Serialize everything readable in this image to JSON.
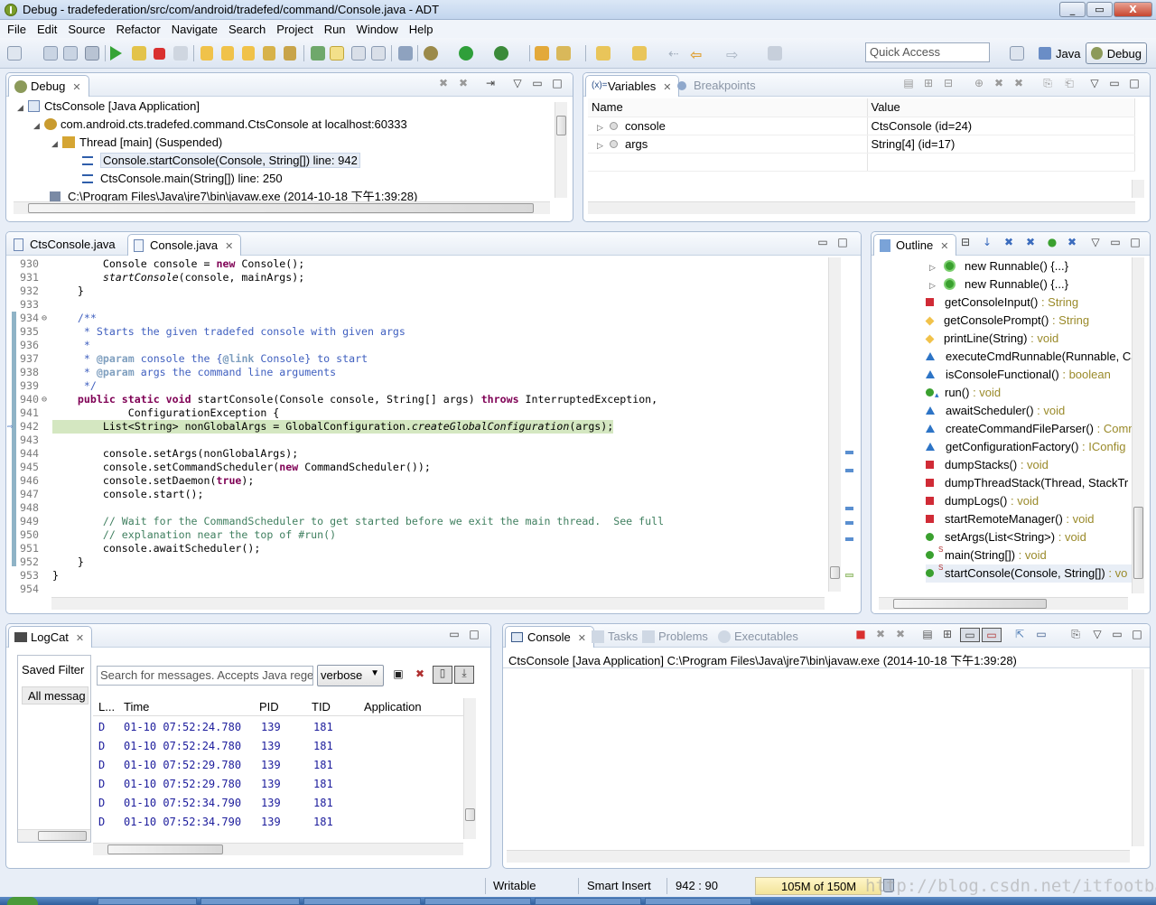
{
  "window": {
    "title": "Debug - tradefederation/src/com/android/tradefed/command/Console.java - ADT",
    "buttons": [
      "_",
      "▭",
      "X"
    ]
  },
  "menu": [
    "File",
    "Edit",
    "Source",
    "Refactor",
    "Navigate",
    "Search",
    "Project",
    "Run",
    "Window",
    "Help"
  ],
  "toolbar": {
    "quick_access_placeholder": "Quick Access",
    "perspectives": [
      "Java",
      "Debug"
    ]
  },
  "debug_view": {
    "tab": "Debug",
    "tree": [
      {
        "label": "CtsConsole [Java Application]"
      },
      {
        "label": "com.android.cts.tradefed.command.CtsConsole at localhost:60333"
      },
      {
        "label": "Thread [main] (Suspended)"
      },
      {
        "label": "Console.startConsole(Console, String[]) line: 942"
      },
      {
        "label": "CtsConsole.main(String[]) line: 250"
      },
      {
        "label": "C:\\Program Files\\Java\\jre7\\bin\\javaw.exe (2014-10-18 下午1:39:28)"
      }
    ]
  },
  "variables_view": {
    "tabs": [
      "Variables",
      "Breakpoints"
    ],
    "columns": [
      "Name",
      "Value"
    ],
    "rows": [
      {
        "name": "console",
        "value": "CtsConsole  (id=24)"
      },
      {
        "name": "args",
        "value": "String[4]  (id=17)"
      }
    ]
  },
  "editor": {
    "tabs": [
      "CtsConsole.java",
      "Console.java"
    ],
    "lines": [
      {
        "n": "930",
        "t": "        Console console = new Console();"
      },
      {
        "n": "931",
        "t": "        startConsole(console, mainArgs);"
      },
      {
        "n": "932",
        "t": "    }"
      },
      {
        "n": "933",
        "t": ""
      },
      {
        "n": "934",
        "t": "    /**"
      },
      {
        "n": "935",
        "t": "     * Starts the given tradefed console with given args"
      },
      {
        "n": "936",
        "t": "     *"
      },
      {
        "n": "937",
        "t": "     * @param console the {@link Console} to start"
      },
      {
        "n": "938",
        "t": "     * @param args the command line arguments"
      },
      {
        "n": "939",
        "t": "     */"
      },
      {
        "n": "940",
        "t": "    public static void startConsole(Console console, String[] args) throws InterruptedException,"
      },
      {
        "n": "941",
        "t": "            ConfigurationException {"
      },
      {
        "n": "942",
        "t": "        List<String> nonGlobalArgs = GlobalConfiguration.createGlobalConfiguration(args);"
      },
      {
        "n": "943",
        "t": ""
      },
      {
        "n": "944",
        "t": "        console.setArgs(nonGlobalArgs);"
      },
      {
        "n": "945",
        "t": "        console.setCommandScheduler(new CommandScheduler());"
      },
      {
        "n": "946",
        "t": "        console.setDaemon(true);"
      },
      {
        "n": "947",
        "t": "        console.start();"
      },
      {
        "n": "948",
        "t": ""
      },
      {
        "n": "949",
        "t": "        // Wait for the CommandScheduler to get started before we exit the main thread.  See full"
      },
      {
        "n": "950",
        "t": "        // explanation near the top of #run()"
      },
      {
        "n": "951",
        "t": "        console.awaitScheduler();"
      },
      {
        "n": "952",
        "t": "    }"
      },
      {
        "n": "953",
        "t": "}"
      },
      {
        "n": "954",
        "t": ""
      }
    ]
  },
  "outline": {
    "tab": "Outline",
    "items": [
      {
        "name": "new Runnable() {...}",
        "ret": "",
        "icon": "anon-class-icon"
      },
      {
        "name": "new Runnable() {...}",
        "ret": "",
        "icon": "anon-class-icon"
      },
      {
        "name": "getConsoleInput()",
        "ret": " : String",
        "icon": "private-method-icon"
      },
      {
        "name": "getConsolePrompt()",
        "ret": " : String",
        "icon": "protected-method-icon"
      },
      {
        "name": "printLine(String)",
        "ret": " : void",
        "icon": "protected-method-icon"
      },
      {
        "name": "executeCmdRunnable(Runnable, Ca",
        "ret": "",
        "icon": "default-method-icon"
      },
      {
        "name": "isConsoleFunctional()",
        "ret": " : boolean",
        "icon": "default-method-icon"
      },
      {
        "name": "run()",
        "ret": " : void",
        "icon": "public-method-icon"
      },
      {
        "name": "awaitScheduler()",
        "ret": " : void",
        "icon": "default-method-icon"
      },
      {
        "name": "createCommandFileParser()",
        "ret": " : Comm",
        "icon": "default-method-icon"
      },
      {
        "name": "getConfigurationFactory()",
        "ret": " : IConfig",
        "icon": "default-method-icon"
      },
      {
        "name": "dumpStacks()",
        "ret": " : void",
        "icon": "private-method-icon"
      },
      {
        "name": "dumpThreadStack(Thread, StackTr",
        "ret": "",
        "icon": "private-method-icon"
      },
      {
        "name": "dumpLogs()",
        "ret": " : void",
        "icon": "private-method-icon"
      },
      {
        "name": "startRemoteManager()",
        "ret": " : void",
        "icon": "private-method-icon"
      },
      {
        "name": "setArgs(List<String>)",
        "ret": " : void",
        "icon": "public-method-icon"
      },
      {
        "name": "main(String[])",
        "ret": " : void",
        "icon": "public-static-method-icon"
      },
      {
        "name": "startConsole(Console, String[])",
        "ret": " : vo",
        "icon": "public-static-method-icon"
      }
    ]
  },
  "logcat": {
    "tab": "LogCat",
    "saved_filters_label": "Saved Filter",
    "all_messages_label": "All messag",
    "search_placeholder": "Search for messages. Accepts Java rege",
    "level_select": "verbose",
    "columns": [
      "L...",
      "Time",
      "PID",
      "TID",
      "Application"
    ],
    "rows": [
      {
        "level": "D",
        "time": "01-10 07:52:24.780",
        "pid": "139",
        "tid": "181"
      },
      {
        "level": "D",
        "time": "01-10 07:52:24.780",
        "pid": "139",
        "tid": "181"
      },
      {
        "level": "D",
        "time": "01-10 07:52:29.780",
        "pid": "139",
        "tid": "181"
      },
      {
        "level": "D",
        "time": "01-10 07:52:29.780",
        "pid": "139",
        "tid": "181"
      },
      {
        "level": "D",
        "time": "01-10 07:52:34.790",
        "pid": "139",
        "tid": "181"
      },
      {
        "level": "D",
        "time": "01-10 07:52:34.790",
        "pid": "139",
        "tid": "181"
      }
    ]
  },
  "console": {
    "tabs": [
      "Console",
      "Tasks",
      "Problems",
      "Executables"
    ],
    "header": "CtsConsole [Java Application] C:\\Program Files\\Java\\jre7\\bin\\javaw.exe (2014-10-18 下午1:39:28)"
  },
  "status": {
    "writable": "Writable",
    "insert_mode": "Smart Insert",
    "position": "942 : 90",
    "heap": "105M of 150M"
  },
  "watermark": "http://blog.csdn.net/itfootball",
  "colors": {
    "keyword": "#7f0055",
    "comment": "#3f7f5f",
    "javadoc": "#3f5fbf",
    "current_line": "#d4e7c1",
    "panel_border": "#a9bbd3"
  }
}
